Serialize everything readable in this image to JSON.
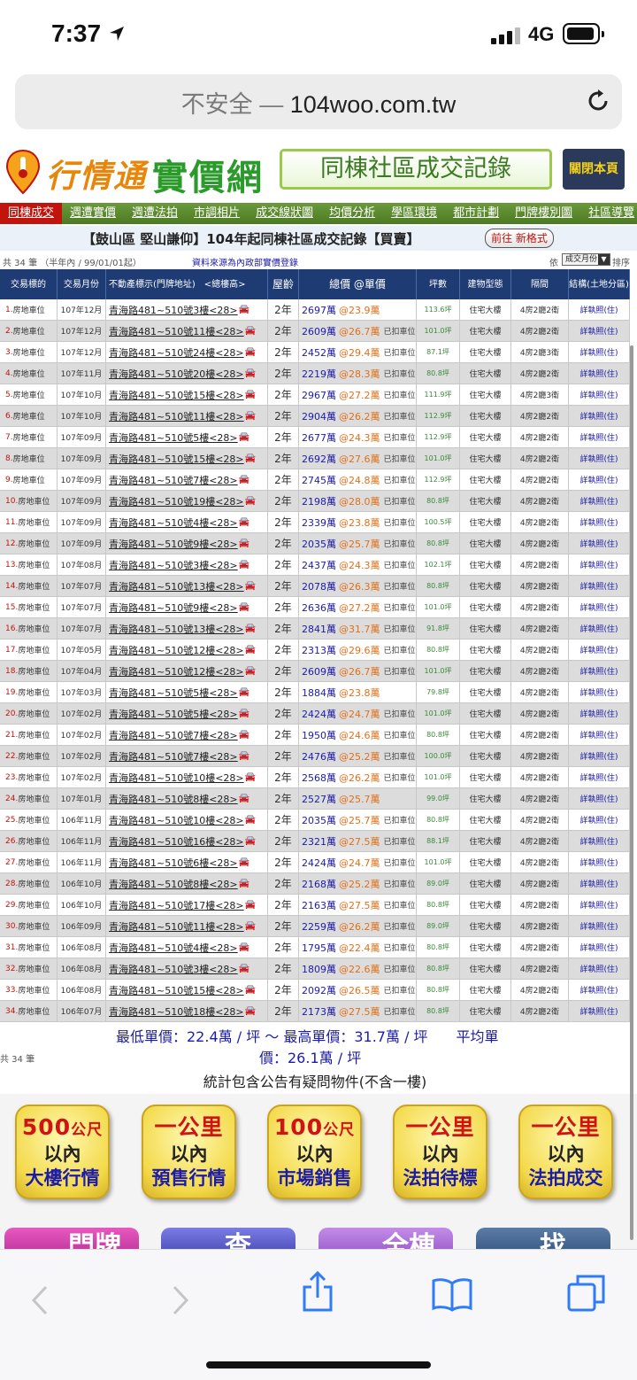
{
  "status": {
    "time": "7:37",
    "network": "4G"
  },
  "browser": {
    "insecure": "不安全 —",
    "domain": "104woo.com.tw"
  },
  "banner": {
    "logo_script": "行情通",
    "logo_main": "實價網",
    "title": "同棟社區成交記錄",
    "close": "關閉本頁"
  },
  "nav": [
    "同棟成交",
    "週遭實價",
    "週遭法拍",
    "市調相片",
    "成交線狀圖",
    "均價分析",
    "學區環境",
    "都市計劃",
    "門牌樓別圖",
    "社區導覽"
  ],
  "subheader": {
    "title": "【鼓山區 堅山謙仰】104年起同棟社區成交記錄【買賣】",
    "new_format": "前往 新格式"
  },
  "info": {
    "count": "共 34 筆 （半年內 / 99/01/01起）",
    "source": "資料來源為內政部實價登錄",
    "sort_label": "依",
    "sort_value": "成交月份",
    "sort_post": "排序"
  },
  "table": {
    "headers": [
      "交易標的",
      "交易月份",
      "不動產標示(門牌地址)　<總樓高>",
      "屋齡",
      "總價 @單價",
      "坪數",
      "建物型態",
      "隔間",
      "結構(土地分區)"
    ],
    "car_icon": "car-icon",
    "rows": [
      {
        "idx": "1.",
        "type": "房地車位",
        "month": "107年12月",
        "addr": "青海路481~510號3樓<28>",
        "age": "2年",
        "total": "2697萬",
        "unit": "@23.9萬",
        "note": "",
        "area": "113.6坪",
        "btype": "住宅大樓",
        "layout": "4房2廳2衛",
        "detail": "詳執照(住)"
      },
      {
        "idx": "2.",
        "type": "房地車位",
        "month": "107年12月",
        "addr": "青海路481~510號11樓<28>",
        "age": "2年",
        "total": "2609萬",
        "unit": "@26.7萬",
        "note": "已扣車位",
        "area": "101.0坪",
        "btype": "住宅大樓",
        "layout": "4房2廳2衛",
        "detail": "詳執照(住)"
      },
      {
        "idx": "3.",
        "type": "房地車位",
        "month": "107年12月",
        "addr": "青海路481~510號24樓<28>",
        "age": "2年",
        "total": "2452萬",
        "unit": "@29.4萬",
        "note": "已扣車位",
        "area": "87.1坪",
        "btype": "住宅大樓",
        "layout": "4房2廳3衛",
        "detail": "詳執照(住)"
      },
      {
        "idx": "4.",
        "type": "房地車位",
        "month": "107年11月",
        "addr": "青海路481~510號20樓<28>",
        "age": "2年",
        "total": "2219萬",
        "unit": "@28.3萬",
        "note": "已扣車位",
        "area": "80.8坪",
        "btype": "住宅大樓",
        "layout": "4房2廳2衛",
        "detail": "詳執照(住)"
      },
      {
        "idx": "5.",
        "type": "房地車位",
        "month": "107年10月",
        "addr": "青海路481~510號15樓<28>",
        "age": "2年",
        "total": "2967萬",
        "unit": "@27.2萬",
        "note": "已扣車位",
        "area": "111.9坪",
        "btype": "住宅大樓",
        "layout": "4房2廳3衛",
        "detail": "詳執照(住)"
      },
      {
        "idx": "6.",
        "type": "房地車位",
        "month": "107年10月",
        "addr": "青海路481~510號11樓<28>",
        "age": "2年",
        "total": "2904萬",
        "unit": "@26.2萬",
        "note": "已扣車位",
        "area": "112.9坪",
        "btype": "住宅大樓",
        "layout": "4房2廳2衛",
        "detail": "詳執照(住)"
      },
      {
        "idx": "7.",
        "type": "房地車位",
        "month": "107年09月",
        "addr": "青海路481~510號5樓<28>",
        "age": "2年",
        "total": "2677萬",
        "unit": "@24.3萬",
        "note": "已扣車位",
        "area": "112.9坪",
        "btype": "住宅大樓",
        "layout": "4房2廳2衛",
        "detail": "詳執照(住)"
      },
      {
        "idx": "8.",
        "type": "房地車位",
        "month": "107年09月",
        "addr": "青海路481~510號15樓<28>",
        "age": "2年",
        "total": "2692萬",
        "unit": "@27.6萬",
        "note": "已扣車位",
        "area": "101.0坪",
        "btype": "住宅大樓",
        "layout": "4房2廳2衛",
        "detail": "詳執照(住)"
      },
      {
        "idx": "9.",
        "type": "房地車位",
        "month": "107年09月",
        "addr": "青海路481~510號7樓<28>",
        "age": "2年",
        "total": "2745萬",
        "unit": "@24.8萬",
        "note": "已扣車位",
        "area": "112.9坪",
        "btype": "住宅大樓",
        "layout": "4房2廳2衛",
        "detail": "詳執照(住)"
      },
      {
        "idx": "10.",
        "type": "房地車位",
        "month": "107年09月",
        "addr": "青海路481~510號19樓<28>",
        "age": "2年",
        "total": "2198萬",
        "unit": "@28.0萬",
        "note": "已扣車位",
        "area": "80.8坪",
        "btype": "住宅大樓",
        "layout": "4房2廳2衛",
        "detail": "詳執照(住)"
      },
      {
        "idx": "11.",
        "type": "房地車位",
        "month": "107年09月",
        "addr": "青海路481~510號4樓<28>",
        "age": "2年",
        "total": "2339萬",
        "unit": "@23.8萬",
        "note": "已扣車位",
        "area": "100.5坪",
        "btype": "住宅大樓",
        "layout": "4房2廳2衛",
        "detail": "詳執照(住)"
      },
      {
        "idx": "12.",
        "type": "房地車位",
        "month": "107年09月",
        "addr": "青海路481~510號9樓<28>",
        "age": "2年",
        "total": "2035萬",
        "unit": "@25.7萬",
        "note": "已扣車位",
        "area": "80.8坪",
        "btype": "住宅大樓",
        "layout": "4房2廳2衛",
        "detail": "詳執照(住)"
      },
      {
        "idx": "13.",
        "type": "房地車位",
        "month": "107年08月",
        "addr": "青海路481~510號3樓<28>",
        "age": "2年",
        "total": "2437萬",
        "unit": "@24.3萬",
        "note": "已扣車位",
        "area": "102.1坪",
        "btype": "住宅大樓",
        "layout": "4房2廳2衛",
        "detail": "詳執照(住)"
      },
      {
        "idx": "14.",
        "type": "房地車位",
        "month": "107年07月",
        "addr": "青海路481~510號13樓<28>",
        "age": "2年",
        "total": "2078萬",
        "unit": "@26.3萬",
        "note": "已扣車位",
        "area": "80.8坪",
        "btype": "住宅大樓",
        "layout": "4房2廳2衛",
        "detail": "詳執照(住)"
      },
      {
        "idx": "15.",
        "type": "房地車位",
        "month": "107年07月",
        "addr": "青海路481~510號9樓<28>",
        "age": "2年",
        "total": "2636萬",
        "unit": "@27.2萬",
        "note": "已扣車位",
        "area": "101.0坪",
        "btype": "住宅大樓",
        "layout": "4房2廳2衛",
        "detail": "詳執照(住)"
      },
      {
        "idx": "16.",
        "type": "房地車位",
        "month": "107年07月",
        "addr": "青海路481~510號13樓<28>",
        "age": "2年",
        "total": "2841萬",
        "unit": "@31.7萬",
        "note": "已扣車位",
        "area": "91.8坪",
        "btype": "住宅大樓",
        "layout": "4房2廳2衛",
        "detail": "詳執照(住)"
      },
      {
        "idx": "17.",
        "type": "房地車位",
        "month": "107年05月",
        "addr": "青海路481~510號12樓<28>",
        "age": "2年",
        "total": "2313萬",
        "unit": "@29.6萬",
        "note": "已扣車位",
        "area": "80.8坪",
        "btype": "住宅大樓",
        "layout": "4房2廳2衛",
        "detail": "詳執照(住)"
      },
      {
        "idx": "18.",
        "type": "房地車位",
        "month": "107年04月",
        "addr": "青海路481~510號12樓<28>",
        "age": "2年",
        "total": "2609萬",
        "unit": "@26.7萬",
        "note": "已扣車位",
        "area": "101.0坪",
        "btype": "住宅大樓",
        "layout": "4房2廳2衛",
        "detail": "詳執照(住)"
      },
      {
        "idx": "19.",
        "type": "房地車位",
        "month": "107年03月",
        "addr": "青海路481~510號5樓<28>",
        "age": "2年",
        "total": "1884萬",
        "unit": "@23.8萬",
        "note": "",
        "area": "79.8坪",
        "btype": "住宅大樓",
        "layout": "4房2廳2衛",
        "detail": "詳執照(住)"
      },
      {
        "idx": "20.",
        "type": "房地車位",
        "month": "107年02月",
        "addr": "青海路481~510號5樓<28>",
        "age": "2年",
        "total": "2424萬",
        "unit": "@24.7萬",
        "note": "已扣車位",
        "area": "101.0坪",
        "btype": "住宅大樓",
        "layout": "4房2廳2衛",
        "detail": "詳執照(住)"
      },
      {
        "idx": "21.",
        "type": "房地車位",
        "month": "107年02月",
        "addr": "青海路481~510號7樓<28>",
        "age": "2年",
        "total": "1950萬",
        "unit": "@24.6萬",
        "note": "已扣車位",
        "area": "80.8坪",
        "btype": "住宅大樓",
        "layout": "4房2廳2衛",
        "detail": "詳執照(住)"
      },
      {
        "idx": "22.",
        "type": "房地車位",
        "month": "107年02月",
        "addr": "青海路481~510號7樓<28>",
        "age": "2年",
        "total": "2476萬",
        "unit": "@25.2萬",
        "note": "已扣車位",
        "area": "100.0坪",
        "btype": "住宅大樓",
        "layout": "4房2廳2衛",
        "detail": "詳執照(住)"
      },
      {
        "idx": "23.",
        "type": "房地車位",
        "month": "107年02月",
        "addr": "青海路481~510號10樓<28>",
        "age": "2年",
        "total": "2568萬",
        "unit": "@26.2萬",
        "note": "已扣車位",
        "area": "101.0坪",
        "btype": "住宅大樓",
        "layout": "4房2廳2衛",
        "detail": "詳執照(住)"
      },
      {
        "idx": "24.",
        "type": "房地車位",
        "month": "107年01月",
        "addr": "青海路481~510號8樓<28>",
        "age": "2年",
        "total": "2527萬",
        "unit": "@25.7萬",
        "note": "",
        "area": "99.0坪",
        "btype": "住宅大樓",
        "layout": "4房2廳2衛",
        "detail": "詳執照(住)"
      },
      {
        "idx": "25.",
        "type": "房地車位",
        "month": "106年11月",
        "addr": "青海路481~510號10樓<28>",
        "age": "2年",
        "total": "2035萬",
        "unit": "@25.7萬",
        "note": "已扣車位",
        "area": "80.8坪",
        "btype": "住宅大樓",
        "layout": "4房2廳2衛",
        "detail": "詳執照(住)"
      },
      {
        "idx": "26.",
        "type": "房地車位",
        "month": "106年11月",
        "addr": "青海路481~510號16樓<28>",
        "age": "2年",
        "total": "2321萬",
        "unit": "@27.5萬",
        "note": "已扣車位",
        "area": "88.1坪",
        "btype": "住宅大樓",
        "layout": "4房2廳2衛",
        "detail": "詳執照(住)"
      },
      {
        "idx": "27.",
        "type": "房地車位",
        "month": "106年11月",
        "addr": "青海路481~510號6樓<28>",
        "age": "2年",
        "total": "2424萬",
        "unit": "@24.7萬",
        "note": "已扣車位",
        "area": "101.0坪",
        "btype": "住宅大樓",
        "layout": "4房2廳2衛",
        "detail": "詳執照(住)"
      },
      {
        "idx": "28.",
        "type": "房地車位",
        "month": "106年10月",
        "addr": "青海路481~510號8樓<28>",
        "age": "2年",
        "total": "2168萬",
        "unit": "@25.2萬",
        "note": "已扣車位",
        "area": "89.0坪",
        "btype": "住宅大樓",
        "layout": "4房2廳2衛",
        "detail": "詳執照(住)"
      },
      {
        "idx": "29.",
        "type": "房地車位",
        "month": "106年10月",
        "addr": "青海路481~510號17樓<28>",
        "age": "2年",
        "total": "2163萬",
        "unit": "@27.5萬",
        "note": "已扣車位",
        "area": "80.8坪",
        "btype": "住宅大樓",
        "layout": "4房2廳2衛",
        "detail": "詳執照(住)"
      },
      {
        "idx": "30.",
        "type": "房地車位",
        "month": "106年09月",
        "addr": "青海路481~510號11樓<28>",
        "age": "2年",
        "total": "2259萬",
        "unit": "@26.2萬",
        "note": "已扣車位",
        "area": "89.0坪",
        "btype": "住宅大樓",
        "layout": "4房2廳2衛",
        "detail": "詳執照(住)"
      },
      {
        "idx": "31.",
        "type": "房地車位",
        "month": "106年08月",
        "addr": "青海路481~510號4樓<28>",
        "age": "2年",
        "total": "1795萬",
        "unit": "@22.4萬",
        "note": "已扣車位",
        "area": "80.8坪",
        "btype": "住宅大樓",
        "layout": "4房2廳2衛",
        "detail": "詳執照(住)"
      },
      {
        "idx": "32.",
        "type": "房地車位",
        "month": "106年08月",
        "addr": "青海路481~510號3樓<28>",
        "age": "2年",
        "total": "1809萬",
        "unit": "@22.6萬",
        "note": "已扣車位",
        "area": "80.8坪",
        "btype": "住宅大樓",
        "layout": "4房2廳2衛",
        "detail": "詳執照(住)"
      },
      {
        "idx": "33.",
        "type": "房地車位",
        "month": "106年08月",
        "addr": "青海路481~510號15樓<28>",
        "age": "2年",
        "total": "2092萬",
        "unit": "@26.5萬",
        "note": "已扣車位",
        "area": "80.8坪",
        "btype": "住宅大樓",
        "layout": "4房2廳2衛",
        "detail": "詳執照(住)"
      },
      {
        "idx": "34.",
        "type": "房地車位",
        "month": "106年07月",
        "addr": "青海路481~510號18樓<28>",
        "age": "2年",
        "total": "2173萬",
        "unit": "@27.5萬",
        "note": "已扣車位",
        "area": "80.8坪",
        "btype": "住宅大樓",
        "layout": "4房2廳2衛",
        "detail": "詳執照(住)"
      }
    ]
  },
  "summary": {
    "line1": "最低單價：22.4萬 / 坪 ～ 最高單價：31.7萬 / 坪　　平均單",
    "line2": "價：26.1萬 / 坪",
    "count": "共 34 筆",
    "stats": "統計包含公告有疑問物件(不含一樓)"
  },
  "buttons": [
    {
      "l1": "500",
      "l1s": "公尺",
      "l2": "以內",
      "l3": "大樓行情"
    },
    {
      "l1": "一公里",
      "l1s": "",
      "l2": "以內",
      "l3": "預售行情"
    },
    {
      "l1": "100",
      "l1s": "公尺",
      "l2": "以內",
      "l3": "市場銷售"
    },
    {
      "l1": "一公里",
      "l1s": "",
      "l2": "以內",
      "l3": "法拍待標"
    },
    {
      "l1": "一公里",
      "l1s": "",
      "l2": "以內",
      "l3": "法拍成交"
    }
  ],
  "buttons2": [
    "門牌",
    "查",
    "全棟",
    "找"
  ],
  "colors": {
    "header_blue": "#1f3b74",
    "nav_green": "#5a8a2e",
    "accent_red": "#c0140d",
    "link_blue": "#1c1ca8",
    "price_orange": "#e0701a"
  }
}
